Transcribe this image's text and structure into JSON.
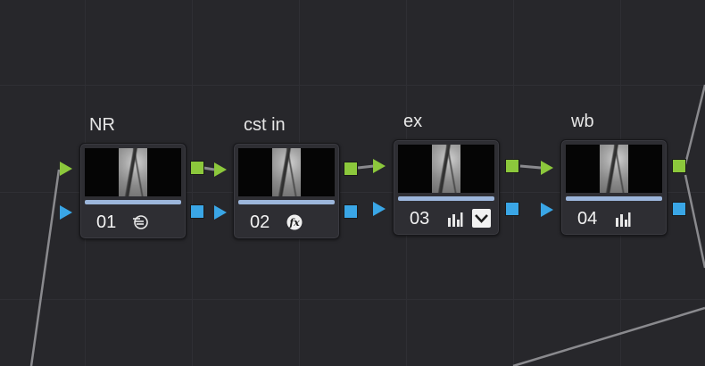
{
  "nodes": [
    {
      "label": "NR",
      "number": "01",
      "icon": "noise-reduction-icon"
    },
    {
      "label": "cst in",
      "number": "02",
      "icon": "fx-icon"
    },
    {
      "label": "ex",
      "number": "03",
      "icon": "levels-icon",
      "extra_icon": "dropdown-check-icon"
    },
    {
      "label": "wb",
      "number": "04",
      "icon": "levels-icon"
    }
  ],
  "colors": {
    "background": "#27272b",
    "rgb_port": "#8cc83c",
    "alpha_port": "#3aa6e6",
    "selection_bar": "#9cb6db"
  }
}
